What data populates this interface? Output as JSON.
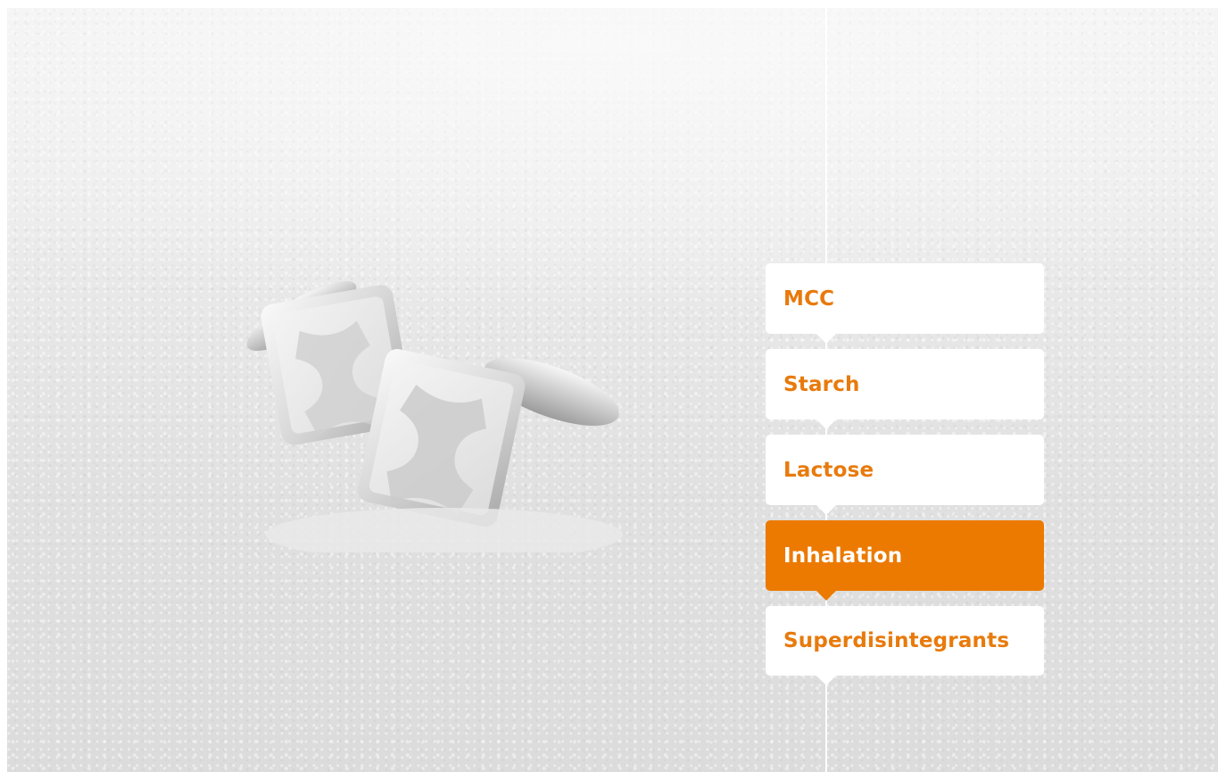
{
  "hero": {
    "image_subject": "cufflinks-in-powder"
  },
  "menu": {
    "items": [
      {
        "label": "MCC",
        "active": false
      },
      {
        "label": "Starch",
        "active": false
      },
      {
        "label": "Lactose",
        "active": false
      },
      {
        "label": "Inhalation",
        "active": true
      },
      {
        "label": "Superdisintegrants",
        "active": false
      }
    ]
  },
  "colors": {
    "accent": "#ec7a00",
    "label_text": "#e87a0c",
    "tile_background": "#ffffff"
  }
}
